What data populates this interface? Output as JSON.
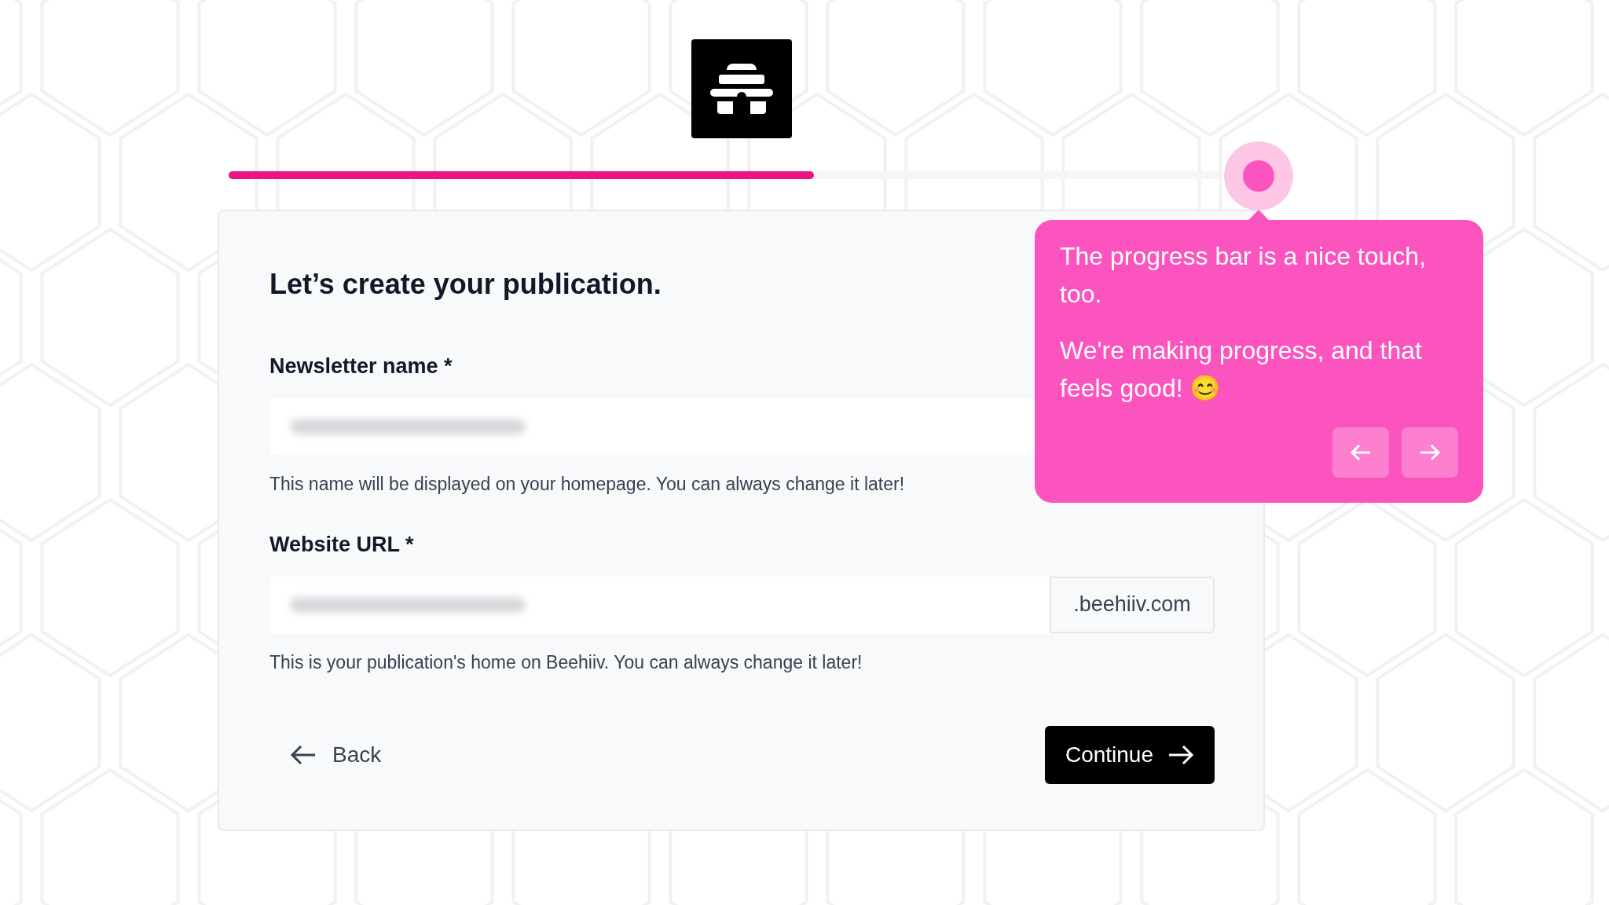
{
  "progress": {
    "level": 0.59
  },
  "form": {
    "title": "Let’s create your publication.",
    "fields": [
      {
        "label": "Newsletter name *",
        "help": "This name will be displayed on your homepage. You can always change it later!"
      },
      {
        "label": "Website URL *",
        "suffix": ".beehiiv.com",
        "help": "This is your publication's home on Beehiiv. You can always change it later!"
      }
    ],
    "back": "Back",
    "continue": "Continue"
  },
  "tooltip": {
    "paragraphs": [
      "The progress bar is a nice touch, too.",
      "We're making progress, and that feels good! 😊"
    ]
  }
}
